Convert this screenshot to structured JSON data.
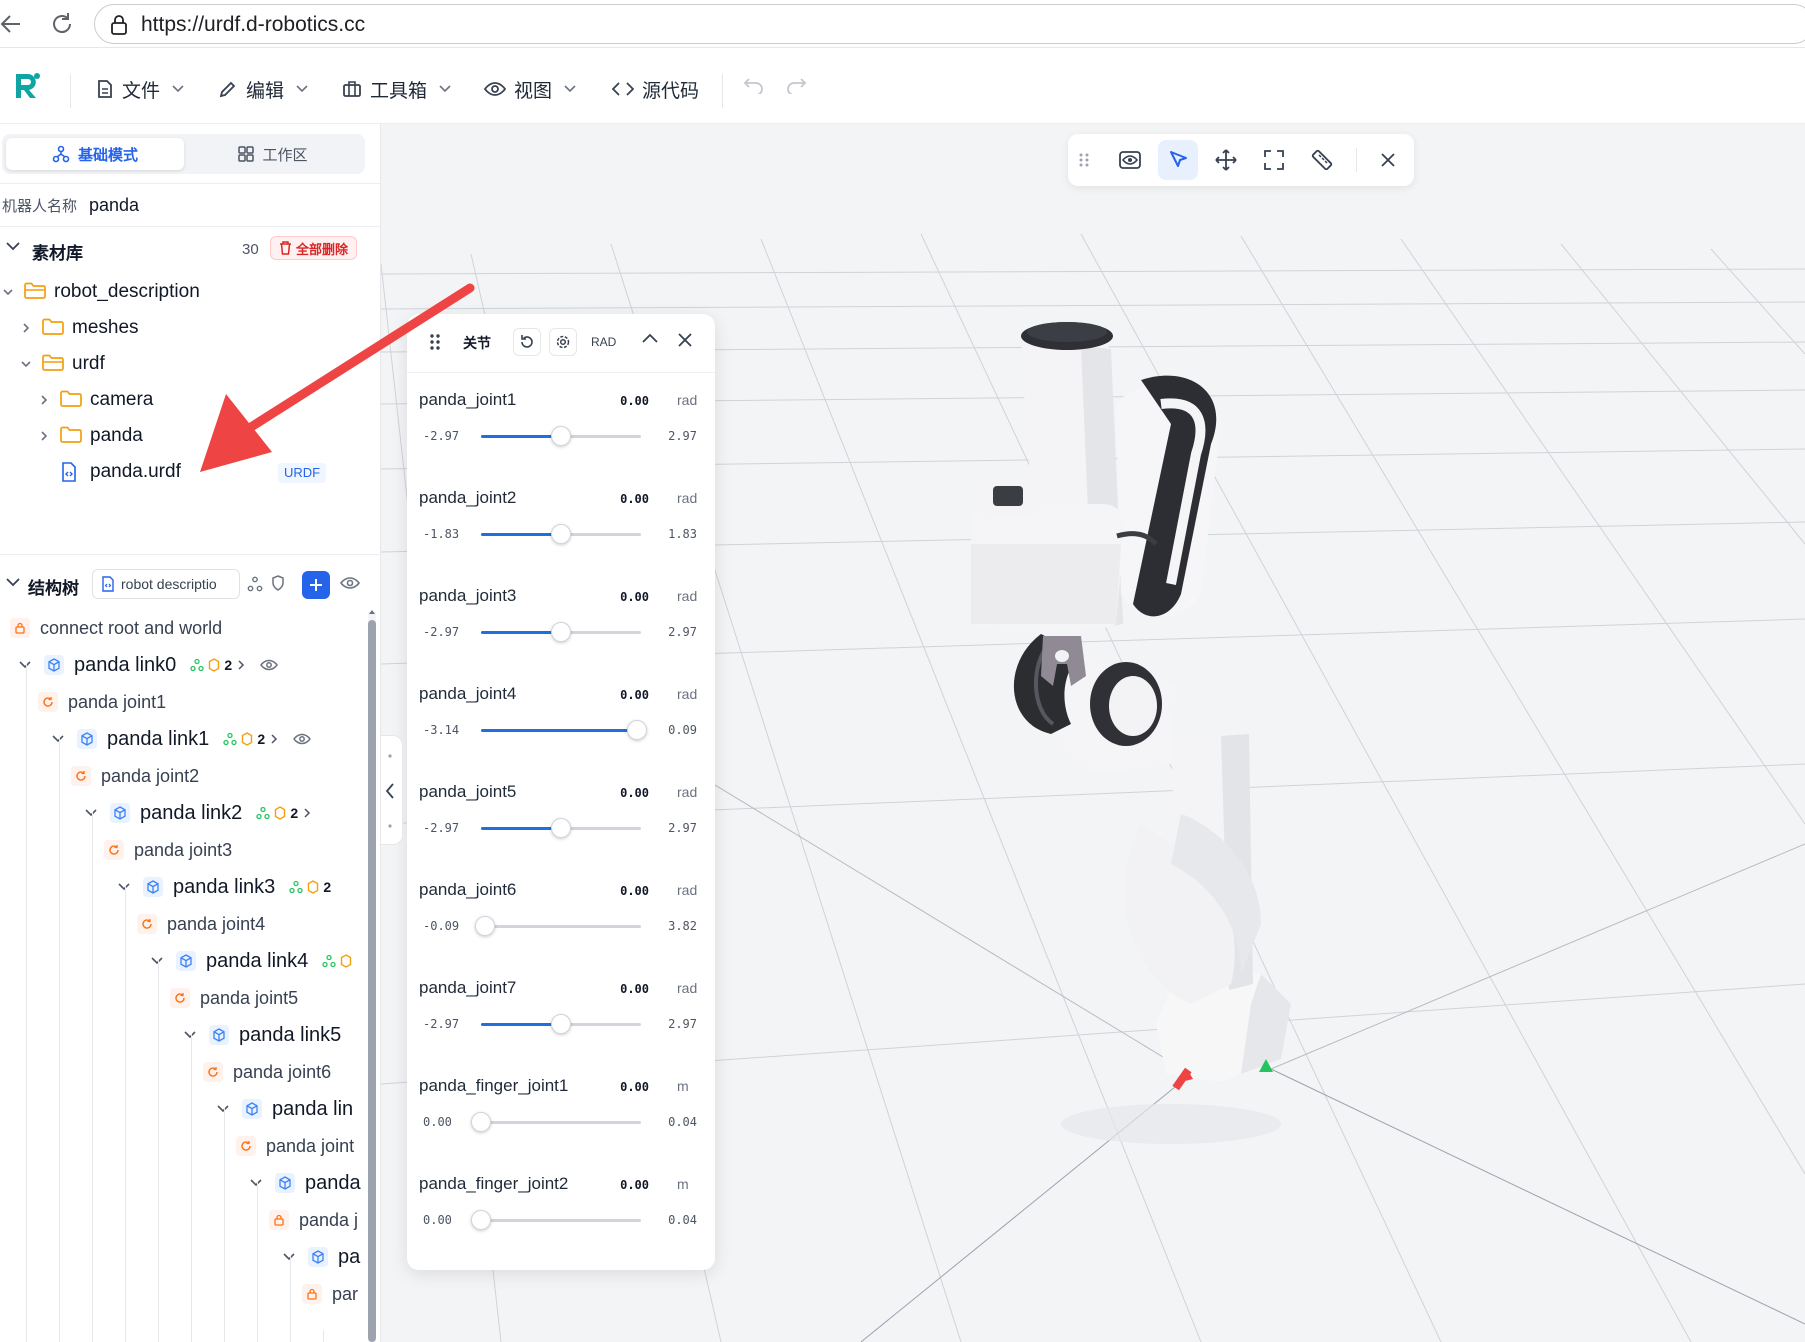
{
  "browser": {
    "url": "https://urdf.d-robotics.cc"
  },
  "toolbar": {
    "menus": [
      {
        "label": "文件",
        "icon": "file-icon"
      },
      {
        "label": "编辑",
        "icon": "pencil-icon"
      },
      {
        "label": "工具箱",
        "icon": "toolbox-icon"
      },
      {
        "label": "视图",
        "icon": "eye-icon"
      },
      {
        "label": "源代码",
        "icon": "code-icon"
      }
    ]
  },
  "left_panel": {
    "modes": {
      "basic": "基础模式",
      "workspace": "工作区"
    },
    "robot_name_label": "机器人名称",
    "robot_name": "panda",
    "assets": {
      "title": "素材库",
      "count": "30",
      "delete_all": "全部删除",
      "files": [
        {
          "name": "robot_description",
          "type": "folder",
          "open": true
        },
        {
          "name": "meshes",
          "type": "folder",
          "open": false
        },
        {
          "name": "urdf",
          "type": "folder",
          "open": true
        },
        {
          "name": "camera",
          "type": "folder",
          "open": false
        },
        {
          "name": "panda",
          "type": "folder",
          "open": false
        },
        {
          "name": "panda.urdf",
          "type": "file",
          "badge": "URDF"
        }
      ]
    },
    "structure": {
      "title": "结构树",
      "file_select": "robot descriptio",
      "nodes": [
        {
          "kind": "joint",
          "label": "connect root and world",
          "fixed": true
        },
        {
          "kind": "link",
          "label": "panda link0",
          "count": "2"
        },
        {
          "kind": "joint",
          "label": "panda joint1"
        },
        {
          "kind": "link",
          "label": "panda link1",
          "count": "2"
        },
        {
          "kind": "joint",
          "label": "panda joint2"
        },
        {
          "kind": "link",
          "label": "panda link2",
          "count": "2"
        },
        {
          "kind": "joint",
          "label": "panda joint3"
        },
        {
          "kind": "link",
          "label": "panda link3",
          "count": "2"
        },
        {
          "kind": "joint",
          "label": "panda joint4"
        },
        {
          "kind": "link",
          "label": "panda link4"
        },
        {
          "kind": "joint",
          "label": "panda joint5"
        },
        {
          "kind": "link",
          "label": "panda link5"
        },
        {
          "kind": "joint",
          "label": "panda joint6"
        },
        {
          "kind": "link",
          "label": "panda lin"
        },
        {
          "kind": "joint",
          "label": "panda joint"
        },
        {
          "kind": "link",
          "label": "panda"
        },
        {
          "kind": "joint",
          "label": "panda j",
          "fixed": true
        },
        {
          "kind": "link",
          "label": "pa"
        },
        {
          "kind": "joint",
          "label": "par",
          "fixed": true
        }
      ]
    }
  },
  "viewport_toolbar": {
    "tools": [
      "eye-view-icon",
      "select-cursor-icon",
      "move-icon",
      "fullscreen-icon",
      "ruler-icon",
      "close-icon"
    ]
  },
  "joints_panel": {
    "title": "关节",
    "unit_toggle": "RAD",
    "joints": [
      {
        "name": "panda_joint1",
        "value": "0.00",
        "unit": "rad",
        "min": "-2.97",
        "max": "2.97",
        "fraction": 0.5
      },
      {
        "name": "panda_joint2",
        "value": "0.00",
        "unit": "rad",
        "min": "-1.83",
        "max": "1.83",
        "fraction": 0.5
      },
      {
        "name": "panda_joint3",
        "value": "0.00",
        "unit": "rad",
        "min": "-2.97",
        "max": "2.97",
        "fraction": 0.5
      },
      {
        "name": "panda_joint4",
        "value": "0.00",
        "unit": "rad",
        "min": "-3.14",
        "max": "0.09",
        "fraction": 0.972
      },
      {
        "name": "panda_joint5",
        "value": "0.00",
        "unit": "rad",
        "min": "-2.97",
        "max": "2.97",
        "fraction": 0.5
      },
      {
        "name": "panda_joint6",
        "value": "0.00",
        "unit": "rad",
        "min": "-0.09",
        "max": "3.82",
        "fraction": 0.023
      },
      {
        "name": "panda_joint7",
        "value": "0.00",
        "unit": "rad",
        "min": "-2.97",
        "max": "2.97",
        "fraction": 0.5
      },
      {
        "name": "panda_finger_joint1",
        "value": "0.00",
        "unit": "m",
        "min": "0.00",
        "max": "0.04",
        "fraction": 0.0
      },
      {
        "name": "panda_finger_joint2",
        "value": "0.00",
        "unit": "m",
        "min": "0.00",
        "max": "0.04",
        "fraction": 0.0
      }
    ]
  },
  "colors": {
    "accent": "#2563eb",
    "slider_fill": "#1f6fe0",
    "danger": "#dc2626",
    "folder": "#f59e0b",
    "joint_badge": "#f97316",
    "link_badge": "#3b82f6",
    "annotation_arrow": "#ef4444"
  }
}
